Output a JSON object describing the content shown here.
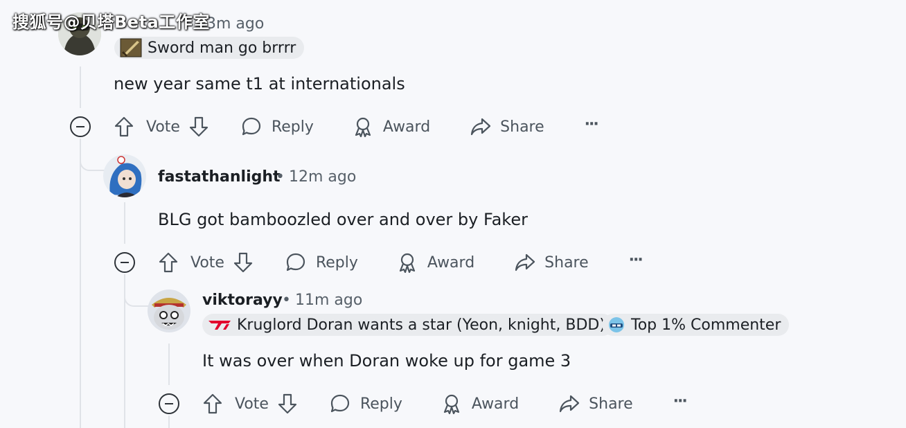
{
  "watermark": {
    "text": "搜狐号@贝塔Beta工作室"
  },
  "comments": [
    {
      "username": "",
      "time": "3m ago",
      "flairs": [
        {
          "text": "Sword man go brrrr",
          "icon": "sword-flair-icon"
        }
      ],
      "body": "new year same t1 at internationals",
      "actions": {
        "vote": "Vote",
        "reply": "Reply",
        "award": "Award",
        "share": "Share",
        "more": "···"
      }
    },
    {
      "username": "fastathanlight",
      "separator": "•",
      "time": "12m ago",
      "body": "BLG got bamboozled over and over by Faker",
      "actions": {
        "vote": "Vote",
        "reply": "Reply",
        "award": "Award",
        "share": "Share",
        "more": "···"
      }
    },
    {
      "username": "viktorayy",
      "separator": "•",
      "time": "11m ago",
      "flairs": [
        {
          "text": "Kruglord Doran wants a star (Yeon, knight, BDD)",
          "icon": "t1-logo-icon"
        },
        {
          "text": "Top 1% Commenter",
          "icon": "commenter-badge-icon"
        }
      ],
      "body": "It was over when Doran woke up for game 3",
      "actions": {
        "vote": "Vote",
        "reply": "Reply",
        "award": "Award",
        "share": "Share",
        "more": "···"
      }
    }
  ],
  "colors": {
    "background": "#f7f8fb",
    "text": "#1b1f24",
    "meta": "#576069",
    "flair_bg": "#e9ebee",
    "thread_line": "#e0e3e8",
    "t1_red": "#e2012d"
  }
}
